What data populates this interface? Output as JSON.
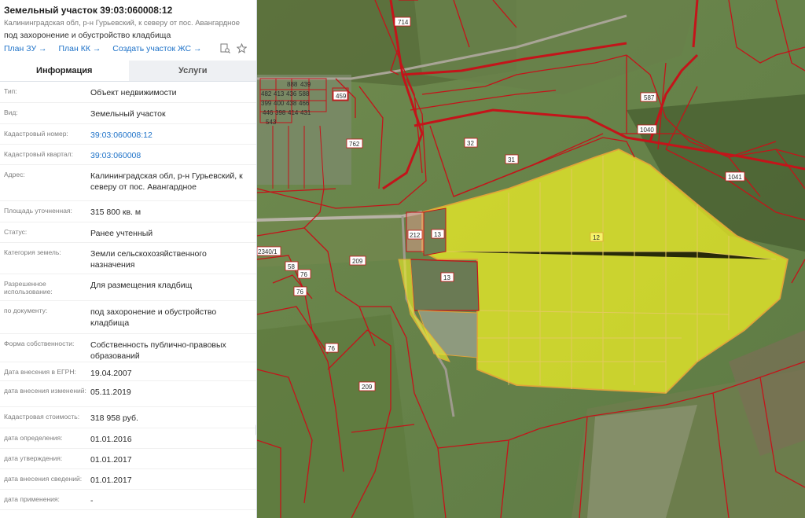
{
  "header": {
    "title": "Земельный участок 39:03:060008:12",
    "address": "Калининградская обл, р-н Гурьевский, к северу от пос. Авангардное",
    "purpose": "под захоронение и обустройство кладбища"
  },
  "links": [
    "План ЗУ →",
    "План КК →",
    "Создать участок ЖС →"
  ],
  "icons": [
    "doc-search-icon",
    "star-icon"
  ],
  "tabs": {
    "info": "Информация",
    "services": "Услуги",
    "active": "info"
  },
  "rows": [
    {
      "label": "Тип:",
      "value": "Объект недвижимости"
    },
    {
      "label": "Вид:",
      "value": "Земельный участок"
    },
    {
      "label": "Кадастровый номер:",
      "value": "39:03:060008:12",
      "link": true
    },
    {
      "label": "Кадастровый квартал:",
      "value": "39:03:060008",
      "link": true
    },
    {
      "label": "Адрес:",
      "value": "Калининградская обл, р-н Гурьевский, к северу от пос. Авангардное"
    },
    {
      "label": "Площадь уточненная:",
      "value": "315 800 кв. м"
    },
    {
      "label": "Статус:",
      "value": "Ранее учтенный"
    },
    {
      "label": "Категория земель:",
      "value": "Земли сельскохозяйственного назначения"
    },
    {
      "label": "Разрешенное использование:",
      "value": "Для размещения кладбищ"
    },
    {
      "label": "по документу:",
      "value": "под захоронение и обустройство кладбища"
    },
    {
      "label": "Форма собственности:",
      "value": "Собственность публично-правовых образований"
    },
    {
      "label": "Дата внесения в ЕГРН:",
      "value": "19.04.2007"
    },
    {
      "label": "дата внесения изменений:",
      "value": "05.11.2019"
    },
    {
      "label": "Кадастровая стоимость:",
      "value": "318 958 руб."
    },
    {
      "label": "дата определения:",
      "value": "01.01.2016"
    },
    {
      "label": "дата утверждения:",
      "value": "01.01.2017"
    },
    {
      "label": "дата внесения сведений:",
      "value": "01.01.2017"
    },
    {
      "label": "дата применения:",
      "value": "-"
    }
  ],
  "map": {
    "selected_parcel": "12",
    "parcel_numbers": [
      "714",
      "587",
      "1040",
      "1041",
      "762",
      "32",
      "31",
      "212",
      "13",
      "13",
      "209",
      "209",
      "76",
      "76",
      "76",
      "58",
      "2340/1",
      "459"
    ],
    "settlement_numbers": [
      "888",
      "439",
      "482",
      "413",
      "436",
      "588",
      "399",
      "400",
      "438",
      "466",
      "446",
      "398",
      "414",
      "431",
      "543"
    ],
    "colors": {
      "boundary": "#c4141a",
      "highlight": "#f2f226",
      "highlight_border": "#e0a43a",
      "link": "#1e72c8"
    }
  }
}
